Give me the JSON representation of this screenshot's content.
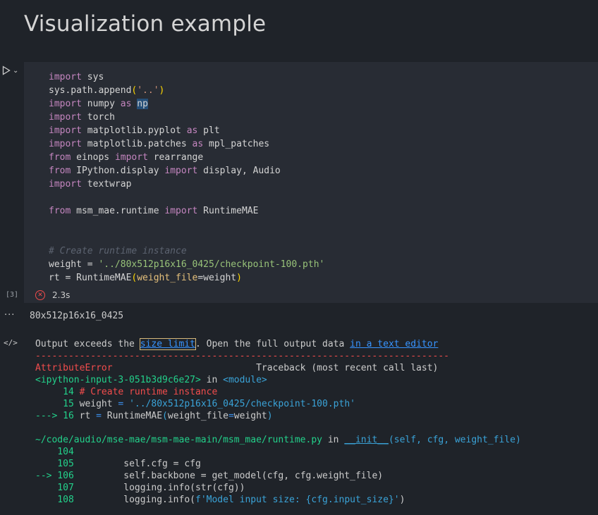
{
  "heading": "Visualization example",
  "cell": {
    "execution_count": "[3]",
    "status_time": "2.3s",
    "code": {
      "l1_kw": "import",
      "l1_rest": " sys",
      "l2_a": "sys.path.append",
      "l2_p1": "(",
      "l2_str": "'..'",
      "l2_p2": ")",
      "l3_kw": "import",
      "l3_mid": " numpy ",
      "l3_as": "as",
      "l3_sp": " ",
      "l3_alias": "np",
      "l4_kw": "import",
      "l4_rest": " torch",
      "l5_kw": "import",
      "l5_mid": " matplotlib.pyplot ",
      "l5_as": "as",
      "l5_rest": " plt",
      "l6_kw": "import",
      "l6_mid": " matplotlib.patches ",
      "l6_as": "as",
      "l6_rest": " mpl_patches",
      "l7_kw": "from",
      "l7_mid": " einops ",
      "l7_imp": "import",
      "l7_rest": " rearrange",
      "l8_kw": "from",
      "l8_mid": " IPython.display ",
      "l8_imp": "import",
      "l8_rest": " display, Audio",
      "l9_kw": "import",
      "l9_rest": " textwrap",
      "l11_kw": "from",
      "l11_mid": " msm_mae.runtime ",
      "l11_imp": "import",
      "l11_rest": " RuntimeMAE",
      "l14_comment": "# Create runtime instance",
      "l15_a": "weight = ",
      "l15_str": "'../80x512p16x16_0425/checkpoint-100.pth'",
      "l16_a": "rt = RuntimeMAE",
      "l16_p1": "(",
      "l16_param": "weight_file",
      "l16_eq": "=weight",
      "l16_p2": ")"
    }
  },
  "output": {
    "stdout": "80x512p16x16_0425",
    "notice_a": "Output exceeds the ",
    "notice_link1": "size limit",
    "notice_b": ". Open the full output data ",
    "notice_link2": "in a text editor",
    "dashes": "---------------------------------------------------------------------------",
    "error_name": "AttributeError",
    "traceback_header": "                          Traceback (most recent call last)",
    "tb1_file": "<ipython-input-3-051b3d9c6e27>",
    "tb1_in": " in ",
    "tb1_mod": "<module>",
    "tb1_l14_no": "     14 ",
    "tb1_l14": "# Create runtime instance",
    "tb1_l15_no": "     15 ",
    "tb1_l15_a": "weight ",
    "tb1_l15_eq": "= ",
    "tb1_l15_str": "'../80x512p16x16_0425/checkpoint-100.pth'",
    "tb1_l16_arrow": "---> 16 ",
    "tb1_l16_a": "rt ",
    "tb1_l16_eq": "= ",
    "tb1_l16_fn": "RuntimeMAE",
    "tb1_l16_p1": "(",
    "tb1_l16_arg": "weight_file",
    "tb1_l16_eq2": "=",
    "tb1_l16_val": "weight",
    "tb1_l16_p2": ")",
    "tb2_file": "~/code/audio/mse-mae/msm-mae-main/msm_mae/runtime.py",
    "tb2_in": " in ",
    "tb2_fn": "__init__",
    "tb2_args": "(self, cfg, weight_file)",
    "tb2_l104": "    104",
    "tb2_l105_no": "    105 ",
    "tb2_l105": "        self.cfg = cfg",
    "tb2_l106_arrow": "--> 106 ",
    "tb2_l106": "        self.backbone = get_model(cfg, cfg.weight_file)",
    "tb2_l107_no": "    107 ",
    "tb2_l107": "        logging.info(str(cfg))",
    "tb2_l108_no": "    108 ",
    "tb2_l108_a": "        logging.info(",
    "tb2_l108_str": "f'Model input size: {cfg.input_size}'",
    "tb2_l108_b": ")"
  },
  "icons": {
    "run": "play-icon",
    "expand": "chevron-down-icon",
    "error": "error-circle-icon",
    "more": "more-horizontal-icon",
    "code": "code-output-icon"
  }
}
